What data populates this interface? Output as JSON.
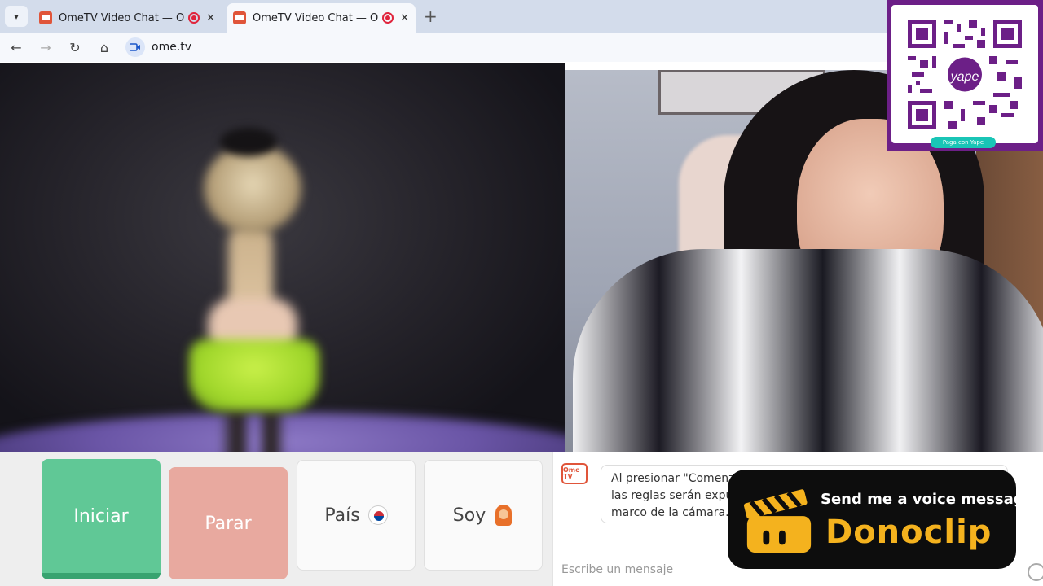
{
  "browser": {
    "tabs": [
      {
        "title": "OmeTV Video Chat — Ome",
        "active": false
      },
      {
        "title": "OmeTV Video Chat — Ome",
        "active": true
      }
    ],
    "url": "ome.tv"
  },
  "qr_overlay": {
    "brand": "yape",
    "caption": "Paga con Yape"
  },
  "controls": {
    "start_label": "Iniciar",
    "stop_label": "Parar",
    "country_label": "País",
    "gender_label": "Soy"
  },
  "chat": {
    "logo": "Ome TV",
    "system_message": "Al presionar \"Comenza... las reglas serán expu... marco de la cámara.",
    "system_message_lines": [
      "Al presionar \"Comenza",
      "las reglas serán expu",
      "marco de la cámara."
    ],
    "input_placeholder": "Escribe un mensaje"
  },
  "donoclip": {
    "subtitle": "Send me a voice message",
    "brand": "Donoclip"
  },
  "colors": {
    "start_button": "#60c896",
    "stop_button": "#e8a99f",
    "brand_orange": "#e0553a",
    "yape_purple": "#6c1f87",
    "donoclip_yellow": "#f4b21e"
  }
}
